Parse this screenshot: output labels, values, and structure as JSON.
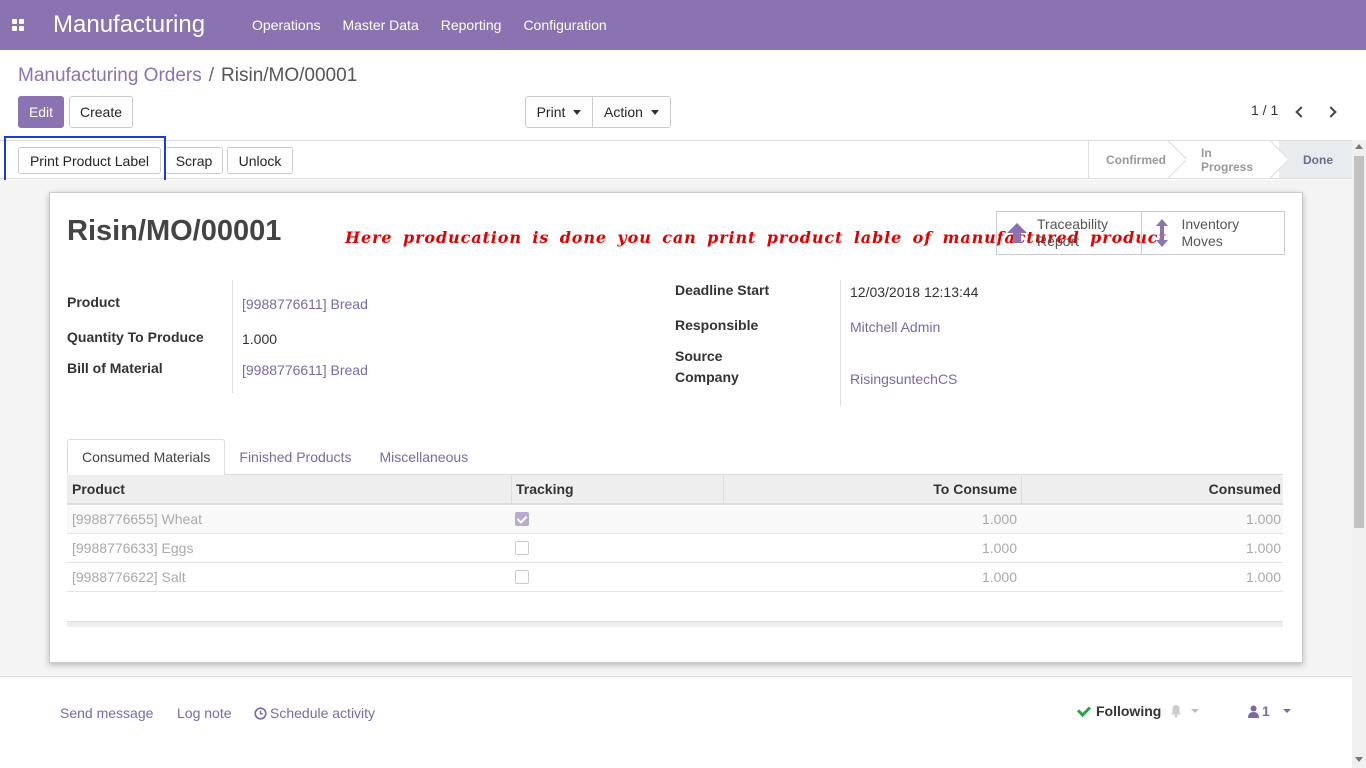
{
  "navbar": {
    "app_title": "Manufacturing",
    "menu": [
      "Operations",
      "Master Data",
      "Reporting",
      "Configuration"
    ]
  },
  "breadcrumb": {
    "parent": "Manufacturing Orders",
    "separator": "/",
    "current": "Risin/MO/00001"
  },
  "toolbar": {
    "edit_label": "Edit",
    "create_label": "Create",
    "print_label": "Print",
    "action_label": "Action"
  },
  "pager": {
    "value": "1 / 1"
  },
  "statusbar": {
    "buttons": [
      "Print Product Label",
      "Scrap",
      "Unlock"
    ],
    "stages": [
      "Confirmed",
      "In Progress",
      "Done"
    ],
    "active_stage": "Done"
  },
  "form": {
    "title": "Risin/MO/00001",
    "annotation": "Here producation is done you can print product lable of manufactured product",
    "smart_buttons": [
      {
        "label_line1": "Traceability",
        "label_line2": "Report",
        "icon": "arrow-up-icon"
      },
      {
        "label_line1": "Inventory",
        "label_line2": "Moves",
        "icon": "arrows-vertical-icon"
      }
    ],
    "left_fields": {
      "product_label": "Product",
      "product_value": "[9988776611] Bread",
      "qty_label": "Quantity To Produce",
      "qty_value": "1.000",
      "bom_label": "Bill of Material",
      "bom_value": "[9988776611] Bread"
    },
    "right_fields": {
      "deadline_label": "Deadline Start",
      "deadline_value": "12/03/2018 12:13:44",
      "responsible_label": "Responsible",
      "responsible_value": "Mitchell Admin",
      "source_label": "Source",
      "company_label": "Company",
      "company_value": "RisingsuntechCS"
    }
  },
  "tabs": [
    "Consumed Materials",
    "Finished Products",
    "Miscellaneous"
  ],
  "table": {
    "headers": [
      "Product",
      "Tracking",
      "To Consume",
      "Consumed"
    ],
    "rows": [
      {
        "product": "[9988776655] Wheat",
        "tracking": true,
        "to_consume": "1.000",
        "consumed": "1.000"
      },
      {
        "product": "[9988776633] Eggs",
        "tracking": false,
        "to_consume": "1.000",
        "consumed": "1.000"
      },
      {
        "product": "[9988776622] Salt",
        "tracking": false,
        "to_consume": "1.000",
        "consumed": "1.000"
      }
    ]
  },
  "chatter": {
    "send_message": "Send message",
    "log_note": "Log note",
    "schedule_activity": "Schedule activity",
    "following": "Following",
    "followers_count": "1"
  },
  "colors": {
    "brand": "#8a73b0",
    "annotation": "#e00000",
    "highlight_box": "#1a3fd0"
  }
}
